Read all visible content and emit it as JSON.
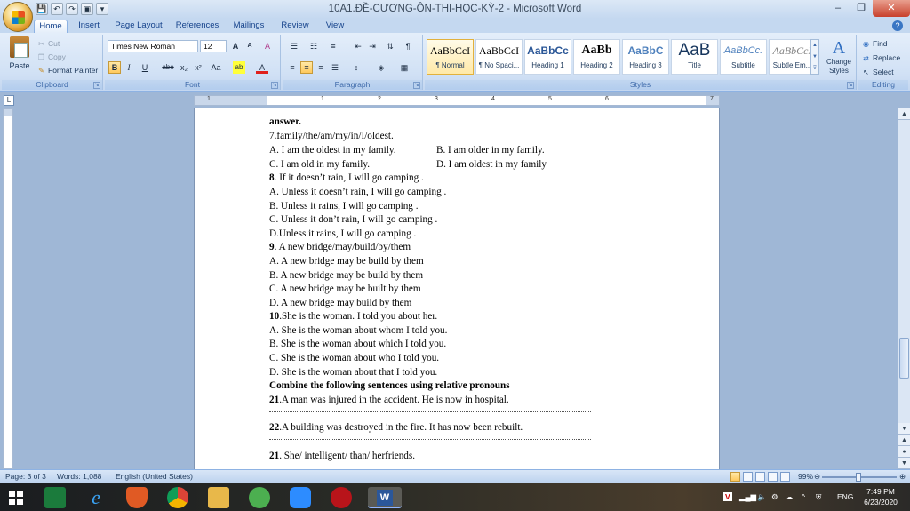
{
  "window": {
    "title": "10A1.ĐỀ-CƯƠNG-ÔN-THI-HỌC-KỲ-2 - Microsoft Word",
    "controls": [
      "–",
      "❐",
      "✕"
    ]
  },
  "qat": [
    "💾",
    "↶",
    "↷",
    "▣",
    "▾"
  ],
  "tabs": [
    "Home",
    "Insert",
    "Page Layout",
    "References",
    "Mailings",
    "Review",
    "View"
  ],
  "ribbon": {
    "clipboard": {
      "label": "Clipboard",
      "paste": "Paste",
      "cut": "Cut",
      "copy": "Copy",
      "format_painter": "Format Painter"
    },
    "font": {
      "label": "Font",
      "font_name": "Times New Roman",
      "font_size": "12",
      "grow": "A",
      "shrink": "A",
      "clear": "A",
      "bold": "B",
      "italic": "I",
      "underline": "U",
      "strike": "abe",
      "sub": "x₂",
      "sup": "x²",
      "case": "Aa",
      "highlight": "ab",
      "color": "A"
    },
    "paragraph": {
      "label": "Paragraph"
    },
    "styles": {
      "label": "Styles",
      "items": [
        {
          "sample": "AaBbCcI",
          "name": "¶ Normal"
        },
        {
          "sample": "AaBbCcI",
          "name": "¶ No Spaci..."
        },
        {
          "sample": "AaBbCc",
          "name": "Heading 1"
        },
        {
          "sample": "AaBb",
          "name": "Heading 2"
        },
        {
          "sample": "AaBbC",
          "name": "Heading 3"
        },
        {
          "sample": "AaB",
          "name": "Title"
        },
        {
          "sample": "AaBbCc.",
          "name": "Subtitle"
        },
        {
          "sample": "AaBbCcI",
          "name": "Subtle Em..."
        }
      ],
      "change": "Change Styles"
    },
    "editing": {
      "label": "Editing",
      "find": "Find",
      "replace": "Replace",
      "select": "Select"
    }
  },
  "ruler": {
    "numbers": [
      "1",
      "1",
      "2",
      "3",
      "4",
      "5",
      "6",
      "7"
    ]
  },
  "document": {
    "lines": [
      {
        "text": "answer.",
        "bold": true
      },
      {
        "text": "7.family/the/am/my/in/I/oldest.",
        "bold_prefix": ""
      },
      {
        "text": "A. I am the oldest in my family.",
        "col2": "B. I am older in my family."
      },
      {
        "text": "C. I am old in my family.",
        "col2": "D. I am oldest in my family"
      },
      {
        "prefix": "8",
        "text": ". If it doesn’t rain, I will go camping ."
      },
      {
        "text": "A. Unless it doesn’t rain, I will go camping ."
      },
      {
        "text": " B. Unless it rains, I will go camping ."
      },
      {
        "text": " C. Unless it don’t rain, I will go camping ."
      },
      {
        "text": " D.Unless it rains, I will go camping ."
      },
      {
        "prefix": "9",
        "text": ". A new bridge/may/build/by/them"
      },
      {
        "text": "A. A new bridge may be build by them"
      },
      {
        "text": "B. A new bridge may be build by them"
      },
      {
        "text": "C. A new bridge may be built by them"
      },
      {
        "text": "D. A new bridge may build by them"
      },
      {
        "prefix": "10",
        "text": ".She is the woman. I told you about her."
      },
      {
        "text": "A. She is the woman about whom I told you."
      },
      {
        "text": "B. She is the woman about which I told you."
      },
      {
        "text": "C. She is the woman about who I told you."
      },
      {
        "text": "D. She is the woman about that I told you."
      },
      {
        "text": "Combine the following sentences using relative pronouns",
        "bold": true
      },
      {
        "prefix": "21",
        "text": ".A man was injured in the accident. He is now in hospital."
      },
      {
        "prefix": "22",
        "text": ".A building was destroyed in the fire.  It has now been rebuilt."
      },
      {
        "prefix": "21",
        "text": ".  She/ intelligent/ than/ herfriends."
      }
    ]
  },
  "status": {
    "page": "Page: 3 of 3",
    "words": "Words: 1,088",
    "language": "English (United States)",
    "zoom": "99%"
  },
  "taskbar": {
    "tray_lang": "ENG",
    "time": "7:49 PM",
    "date": "6/23/2020"
  }
}
